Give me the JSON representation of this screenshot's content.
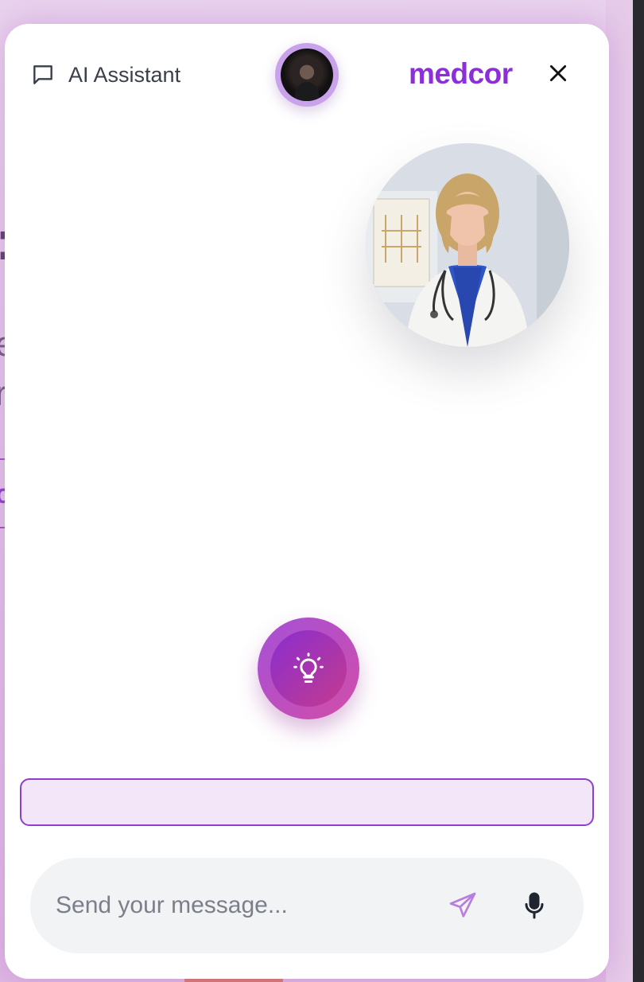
{
  "header": {
    "assistant_label": "AI Assistant",
    "brand": "medcor"
  },
  "composer": {
    "placeholder": "Send your message..."
  },
  "icons": {
    "chat": "chat-bubble-icon",
    "close": "close-icon",
    "idea": "lightbulb-icon",
    "send": "send-icon",
    "mic": "microphone-icon"
  },
  "colors": {
    "brand": "#8b2fd8",
    "accent_gradient_start": "#a550d8",
    "accent_gradient_end": "#d24ea8",
    "suggestion_bg": "#f3e6f8",
    "suggestion_border": "#8b3fcf",
    "composer_bg": "#f2f3f5"
  }
}
